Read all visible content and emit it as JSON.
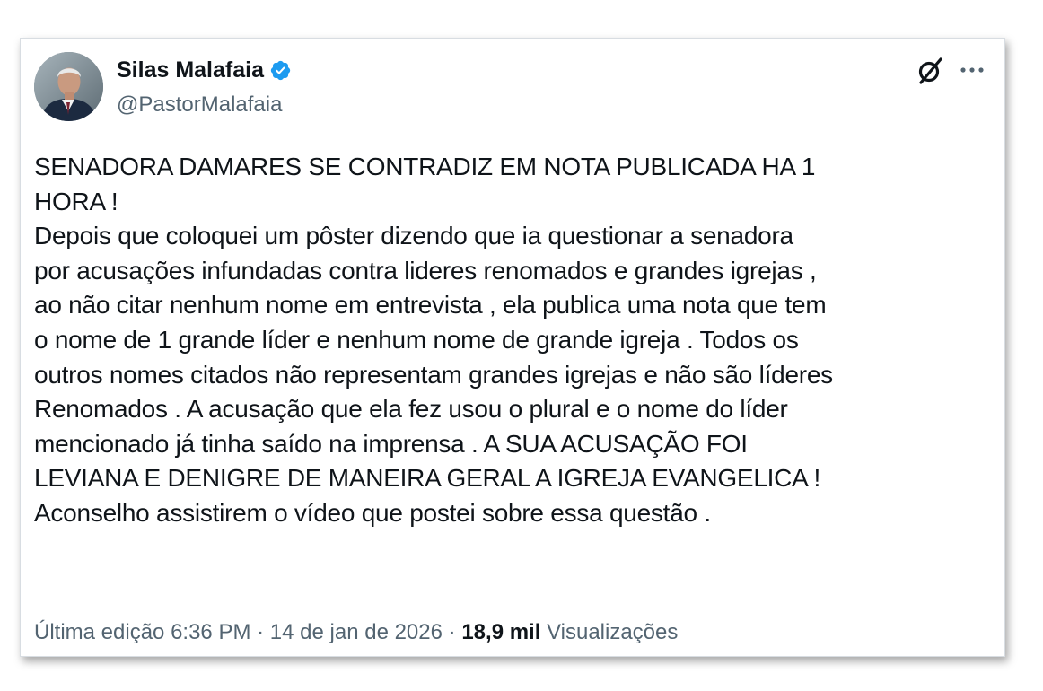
{
  "author": {
    "display_name": "Silas Malafaia",
    "handle": "@PastorMalafaia",
    "verified": true,
    "avatar": "profile-photo"
  },
  "header_actions": {
    "grok_icon": "slashed-circle-icon",
    "more_icon": "more-horizontal-icon"
  },
  "tweet": {
    "lines": [
      "SENADORA DAMARES SE CONTRADIZ EM NOTA PUBLICADA HA 1",
      "HORA !",
      "Depois que coloquei um pôster dizendo que ia questionar a senadora",
      "por acusações infundadas contra lideres renomados e grandes igrejas ,",
      "ao não citar nenhum nome em entrevista , ela publica uma nota que tem",
      "o nome de 1 grande líder e nenhum nome de grande igreja . Todos os",
      "outros nomes citados não representam grandes igrejas e não são líderes",
      "Renomados . A acusação que ela fez usou o plural e o nome do líder",
      "mencionado já tinha saído na imprensa . A SUA ACUSAÇÃO FOI",
      "LEVIANA E DENIGRE DE MANEIRA GERAL A IGREJA EVANGELICA !",
      "Aconselho assistirem o vídeo que postei sobre essa questão ."
    ]
  },
  "meta": {
    "edited_label": "Última edição 6:36 PM",
    "separator": "·",
    "date": "14 de jan de 2026",
    "views_count": "18,9 mil",
    "views_label": "Visualizações"
  },
  "colors": {
    "text_primary": "#0f1419",
    "text_secondary": "#536471",
    "verified_blue": "#1d9bf0"
  }
}
